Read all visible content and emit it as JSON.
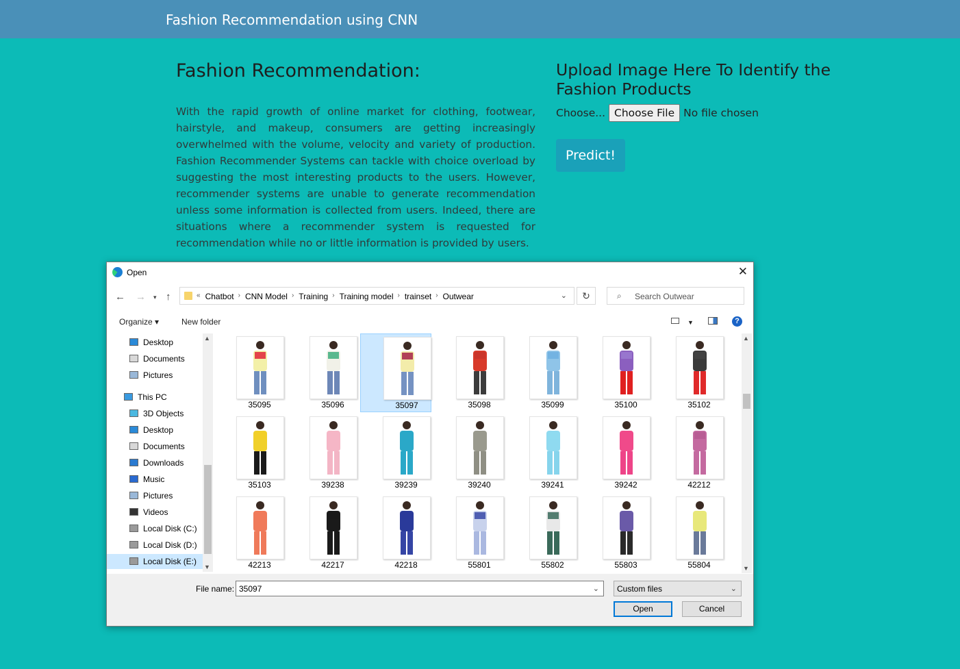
{
  "navbar": {
    "brand": "Fashion Recommendation using CNN"
  },
  "left": {
    "heading": "Fashion Recommendation:",
    "paragraph": "With the rapid growth of online market for clothing, footwear, hairstyle, and makeup, consumers are getting increasingly overwhelmed with the volume, velocity and variety of production. Fashion Recommender Systems can tackle with choice overload by suggesting the most interesting products to the users. However, recommender systems are unable to generate recommendation unless some information is collected from users. Indeed, there are situations where a recommender system is requested for recommendation while no or little information is provided by users."
  },
  "right": {
    "heading": "Upload Image Here To Identify the Fashion Products",
    "choose_label": "Choose...",
    "choose_button": "Choose File",
    "no_file": "No file chosen",
    "predict_button": "Predict!"
  },
  "dialog": {
    "title": "Open",
    "close": "✕",
    "breadcrumb": [
      "Chatbot",
      "CNN Model",
      "Training",
      "Training model",
      "trainset",
      "Outwear"
    ],
    "breadcrumb_prefix": "«",
    "search_placeholder": "Search Outwear",
    "organize": "Organize ▾",
    "new_folder": "New folder",
    "help": "?",
    "sidebar": [
      {
        "label": "Desktop",
        "icon": "desktop-icon"
      },
      {
        "label": "Documents",
        "icon": "documents-icon"
      },
      {
        "label": "Pictures",
        "icon": "pictures-icon"
      },
      {
        "label": "This PC",
        "icon": "this-pc-icon"
      },
      {
        "label": "3D Objects",
        "icon": "3d-objects-icon"
      },
      {
        "label": "Desktop",
        "icon": "desktop-icon"
      },
      {
        "label": "Documents",
        "icon": "documents-icon"
      },
      {
        "label": "Downloads",
        "icon": "downloads-icon"
      },
      {
        "label": "Music",
        "icon": "music-icon"
      },
      {
        "label": "Pictures",
        "icon": "pictures-icon"
      },
      {
        "label": "Videos",
        "icon": "videos-icon"
      },
      {
        "label": "Local Disk (C:)",
        "icon": "drive-icon"
      },
      {
        "label": "Local Disk (D:)",
        "icon": "drive-icon"
      },
      {
        "label": "Local Disk (E:)",
        "icon": "drive-icon"
      }
    ],
    "sidebar_selected": "Local Disk (E:)",
    "files": [
      {
        "name": "35095",
        "top": "#f3f0a8",
        "bottom": "#6f8fbf",
        "accent": "#e0263a"
      },
      {
        "name": "35096",
        "top": "#f1f1e8",
        "bottom": "#6d87b7",
        "accent": "#3fae7e"
      },
      {
        "name": "35097",
        "top": "#f3ecaa",
        "bottom": "#7592c2",
        "accent": "#a4234a"
      },
      {
        "name": "35098",
        "top": "#d83a2a",
        "bottom": "#3c3c3c",
        "accent": "#c8352a"
      },
      {
        "name": "35099",
        "top": "#8fc4e8",
        "bottom": "#7fb4dc",
        "accent": "#6eb0e0"
      },
      {
        "name": "35100",
        "top": "#8b5fbf",
        "bottom": "#e02020",
        "accent": "#9a7ad0"
      },
      {
        "name": "35102",
        "top": "#3b3b3b",
        "bottom": "#e02a2a",
        "accent": "#444444"
      },
      {
        "name": "35103",
        "top": "#f0d02a",
        "bottom": "#1a1a1a",
        "accent": "#f2cf27"
      },
      {
        "name": "39238",
        "top": "#f5b6c6",
        "bottom": "#f3b5c5",
        "accent": "#f5b6c6"
      },
      {
        "name": "39239",
        "top": "#2aa8c8",
        "bottom": "#2aa8c8",
        "accent": "#2aa8c8"
      },
      {
        "name": "39240",
        "top": "#9a9a8e",
        "bottom": "#8f8f84",
        "accent": "#9a9a8e"
      },
      {
        "name": "39241",
        "top": "#8fdaf0",
        "bottom": "#86d4ec",
        "accent": "#8fdaf0"
      },
      {
        "name": "39242",
        "top": "#f04a8a",
        "bottom": "#ee4488",
        "accent": "#f04a8a"
      },
      {
        "name": "42212",
        "top": "#c46aa0",
        "bottom": "#c46aa0",
        "accent": "#b65a92"
      },
      {
        "name": "42213",
        "top": "#f07a5a",
        "bottom": "#ef7a5a",
        "accent": "#f07a5a"
      },
      {
        "name": "42217",
        "top": "#1a1a1a",
        "bottom": "#1a1a1a",
        "accent": "#1a1a1a"
      },
      {
        "name": "42218",
        "top": "#2a3a9a",
        "bottom": "#3545a5",
        "accent": "#2a3a9a"
      },
      {
        "name": "55801",
        "top": "#c8d2ec",
        "bottom": "#aab8e0",
        "accent": "#3a4aa8"
      },
      {
        "name": "55802",
        "top": "#e8e8e8",
        "bottom": "#3a6a5a",
        "accent": "#3a6a5a"
      },
      {
        "name": "55803",
        "top": "#6a5aa8",
        "bottom": "#2a2a2a",
        "accent": "#6a5aa8"
      },
      {
        "name": "55804",
        "top": "#e8e87a",
        "bottom": "#6a7a9a",
        "accent": "#e8e87a"
      }
    ],
    "selected_file": "35097",
    "file_name_label": "File name:",
    "file_name_value": "35097",
    "file_type": "Custom files",
    "open_button": "Open",
    "cancel_button": "Cancel"
  }
}
